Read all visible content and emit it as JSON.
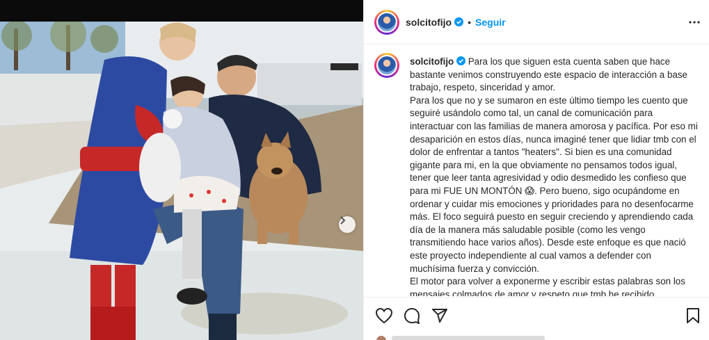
{
  "post": {
    "username": "solcitofijo",
    "dot": "•",
    "follow_label": "Seguir",
    "verified_icon": "verified-badge-icon",
    "more_icon": "more-options-icon",
    "next_icon": "chevron-right-icon",
    "caption": {
      "username": "solcitofijo",
      "text": "Para los que siguen esta cuenta saben que hace bastante venimos construyendo este espacio de interacción a base trabajo, respeto, sinceridad y amor.\nPara los que no y se sumaron en este último tiempo les cuento que seguiré usándolo como tal, un canal de comunicación para interactuar con las familias de manera amorosa y pacífica. Por eso mi desaparición en estos días, nunca imaginé tener que lidiar tmb con el dolor de enfrentar a tantos \"heaters\". Si bien es una comunidad gigante para mi, en la que obviamente no pensamos todos igual, tener que leer tanta agresividad y odio desmedido les confieso que para mi FUE UN MONTÓN 😱. Pero bueno, sigo ocupándome en ordenar y cuidar mis emociones y prioridades para no desenfocarme más. El foco seguirá puesto en seguir creciendo y aprendiendo cada día de la manera más saludable posible (como les vengo transmitiendo hace varios años). Desde este enfoque es que nació este proyecto independiente al cual vamos a defender con muchísima fuerza y convicción.\nEl motor para volver a exponerme y escribir estas palabras son los mensajes colmados de amor y respeto que tmb he recibido."
    },
    "actions": [
      "heart-icon",
      "comment-icon",
      "share-icon",
      "bookmark-icon"
    ]
  },
  "colors": {
    "accent": "#0095f6",
    "text": "#262626",
    "border": "#efefef"
  }
}
